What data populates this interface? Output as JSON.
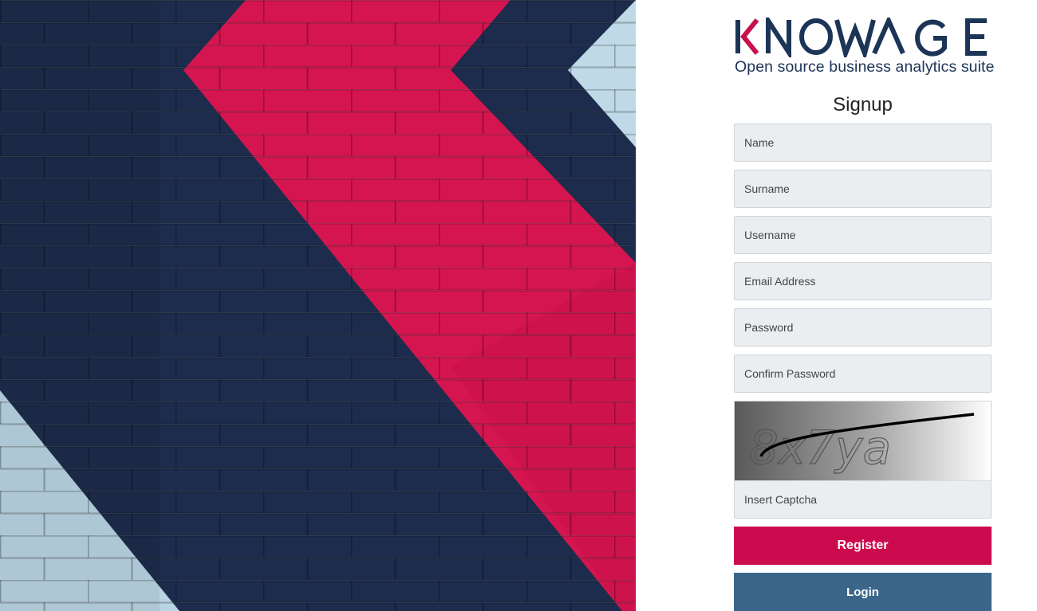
{
  "brand": {
    "logo_text": "KNOWAGE",
    "tagline": "Open source business analytics suite",
    "colors": {
      "navy": "#1c3557",
      "crimson": "#c8104f"
    }
  },
  "form": {
    "title": "Signup",
    "fields": {
      "name": {
        "placeholder": "Name",
        "value": ""
      },
      "surname": {
        "placeholder": "Surname",
        "value": ""
      },
      "username": {
        "placeholder": "Username",
        "value": ""
      },
      "email": {
        "placeholder": "Email Address",
        "value": ""
      },
      "password": {
        "placeholder": "Password",
        "value": ""
      },
      "confirm_password": {
        "placeholder": "Confirm Password",
        "value": ""
      },
      "captcha": {
        "placeholder": "Insert Captcha",
        "value": ""
      }
    },
    "captcha_text": "8x7ya",
    "register_label": "Register",
    "login_label": "Login"
  },
  "theme": {
    "register_color": "#cc0b4e",
    "login_color": "#3b6689",
    "field_bg": "#ebeef1"
  }
}
